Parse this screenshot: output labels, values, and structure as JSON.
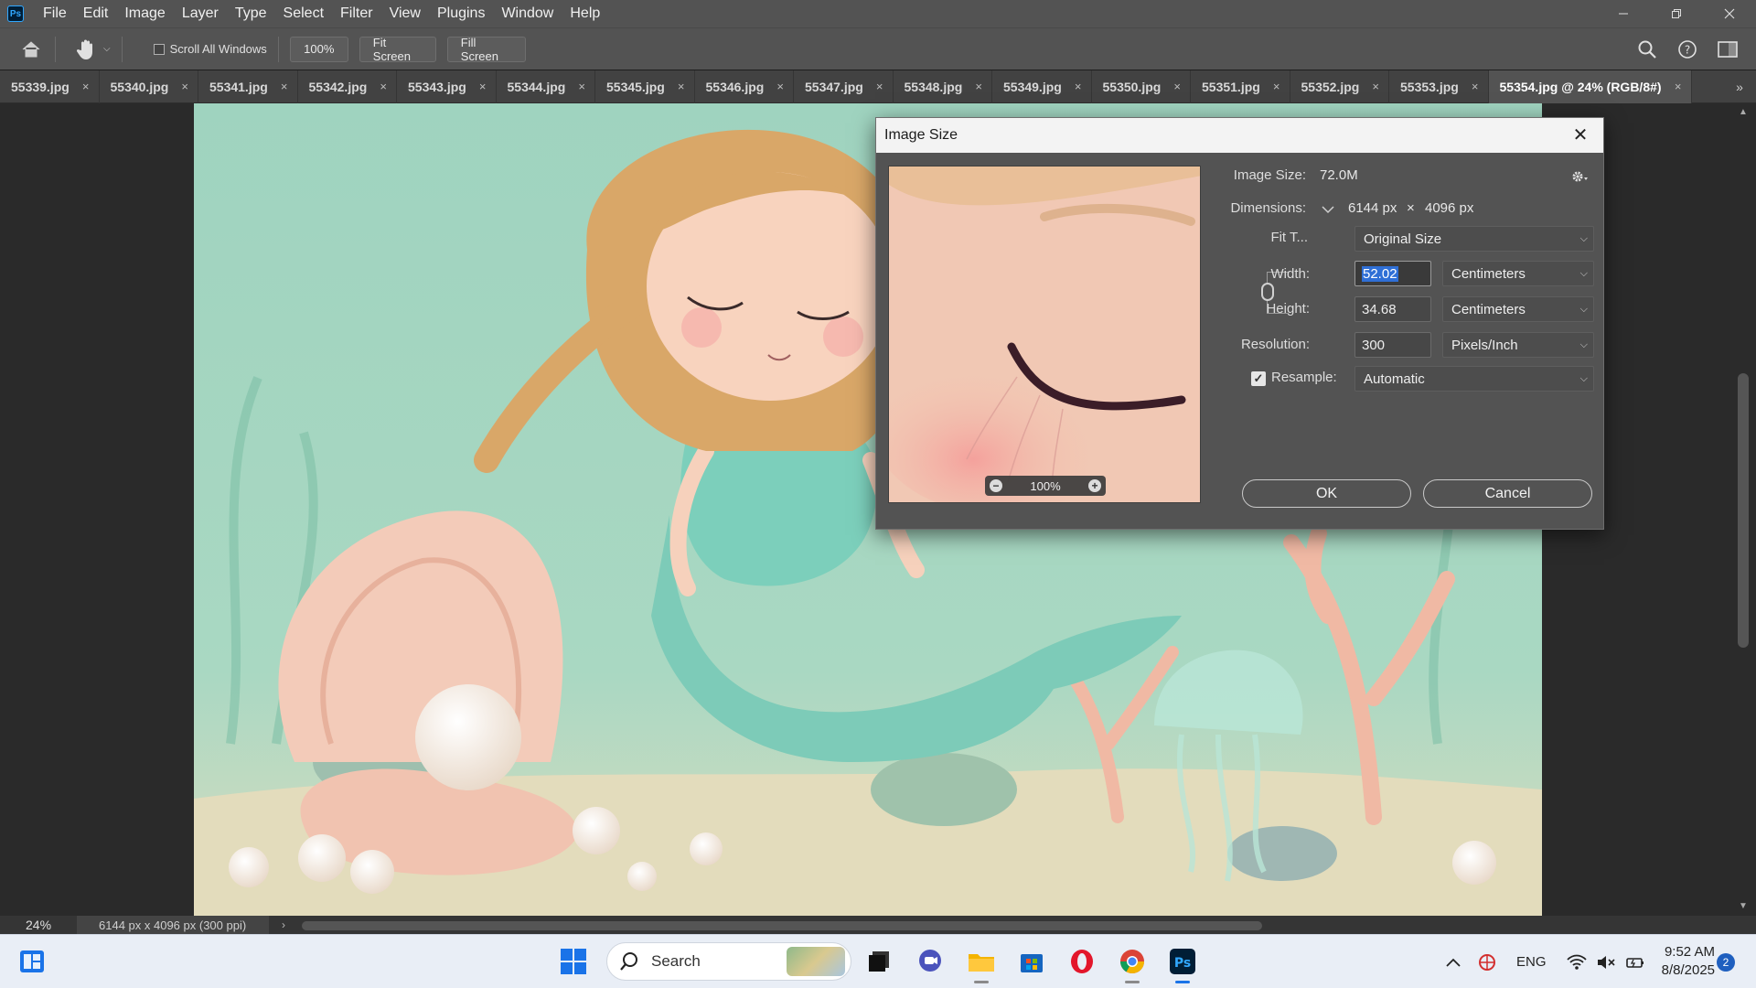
{
  "menubar": {
    "logo": "Ps",
    "items": [
      "File",
      "Edit",
      "Image",
      "Layer",
      "Type",
      "Select",
      "Filter",
      "View",
      "Plugins",
      "Window",
      "Help"
    ]
  },
  "options": {
    "scroll_all_windows": "Scroll All Windows",
    "zoom_value": "100%",
    "fit_screen": "Fit Screen",
    "fill_screen": "Fill Screen"
  },
  "tabs": [
    {
      "label": "55339.jpg"
    },
    {
      "label": "55340.jpg"
    },
    {
      "label": "55341.jpg"
    },
    {
      "label": "55342.jpg"
    },
    {
      "label": "55343.jpg"
    },
    {
      "label": "55344.jpg"
    },
    {
      "label": "55345.jpg"
    },
    {
      "label": "55346.jpg"
    },
    {
      "label": "55347.jpg"
    },
    {
      "label": "55348.jpg"
    },
    {
      "label": "55349.jpg"
    },
    {
      "label": "55350.jpg"
    },
    {
      "label": "55351.jpg"
    },
    {
      "label": "55352.jpg"
    },
    {
      "label": "55353.jpg"
    },
    {
      "label": "55354.jpg @ 24% (RGB/8#)",
      "active": true
    }
  ],
  "tab_close": "×",
  "tab_more": "»",
  "status": {
    "zoom": "24%",
    "doc_info": "6144 px x 4096 px (300 ppi)",
    "arrow": "›"
  },
  "dialog": {
    "title": "Image Size",
    "close": "✕",
    "image_size_label": "Image Size:",
    "image_size_value": "72.0M",
    "dimensions_label": "Dimensions:",
    "dimensions_width": "6144 px",
    "dimensions_x": "×",
    "dimensions_height": "4096 px",
    "fit_to_label": "Fit T...",
    "fit_to_value": "Original Size",
    "width_label": "Width:",
    "width_value": "52.02",
    "width_unit": "Centimeters",
    "height_label": "Height:",
    "height_value": "34.68",
    "height_unit": "Centimeters",
    "resolution_label": "Resolution:",
    "resolution_value": "300",
    "resolution_unit": "Pixels/Inch",
    "resample_label": "Resample:",
    "resample_checked": true,
    "resample_value": "Automatic",
    "preview_zoom": "100%",
    "ok": "OK",
    "cancel": "Cancel"
  },
  "taskbar": {
    "search_placeholder": "Search",
    "language": "ENG",
    "time": "9:52 AM",
    "date": "8/8/2025",
    "notifications": "2"
  },
  "colors": {
    "accent": "#31a8ff",
    "selection": "#2f6fd6",
    "canvas_bg": "#9fd3bf"
  }
}
